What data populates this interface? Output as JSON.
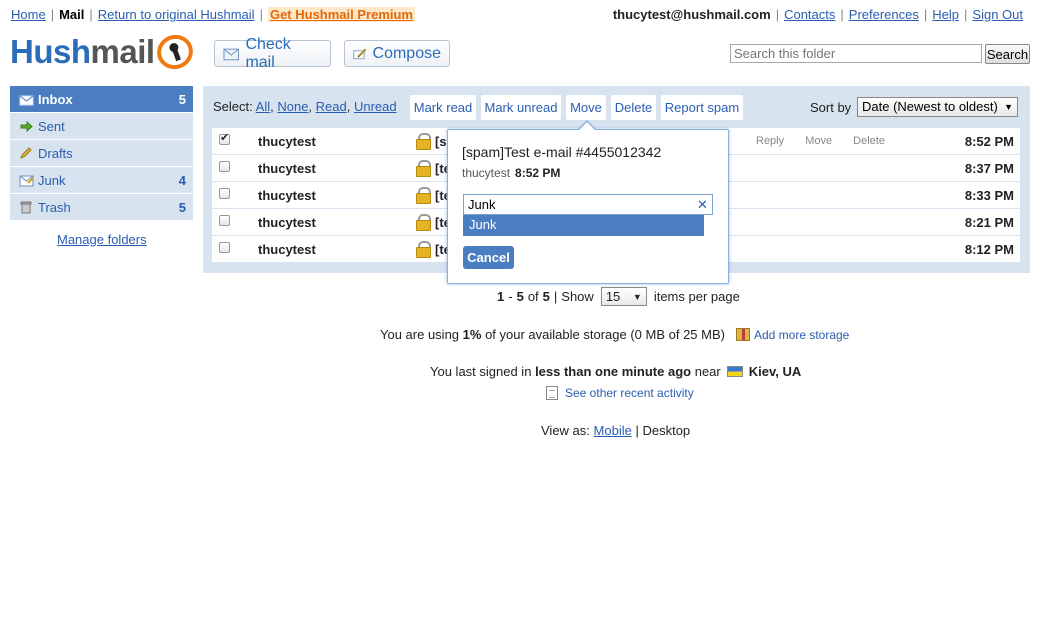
{
  "topnav": {
    "home": "Home",
    "mail": "Mail",
    "return": "Return to original Hushmail",
    "premium": "Get Hushmail Premium"
  },
  "usernav": {
    "email": "thucytest@hushmail.com",
    "contacts": "Contacts",
    "preferences": "Preferences",
    "help": "Help",
    "signout": "Sign Out"
  },
  "logo": {
    "hush": "Hush",
    "mail": "mail"
  },
  "header": {
    "check_mail": "Check mail",
    "compose": "Compose",
    "search_placeholder": "Search this folder",
    "search_button": "Search"
  },
  "sidebar": {
    "folders": [
      {
        "name": "Inbox",
        "count": "5",
        "icon": "inbox-icon"
      },
      {
        "name": "Sent",
        "count": "",
        "icon": "arrow-right-icon"
      },
      {
        "name": "Drafts",
        "count": "",
        "icon": "pencil-icon"
      },
      {
        "name": "Junk",
        "count": "4",
        "icon": "junk-icon"
      },
      {
        "name": "Trash",
        "count": "5",
        "icon": "trash-icon"
      }
    ],
    "manage": "Manage folders"
  },
  "toolbar": {
    "select_label": "Select:",
    "all": "All",
    "none": "None",
    "read": "Read",
    "unread": "Unread",
    "mark_read": "Mark read",
    "mark_unread": "Mark unread",
    "move": "Move",
    "delete": "Delete",
    "report_spam": "Report spam",
    "sort_label": "Sort by",
    "sort_value": "Date (Newest to oldest)"
  },
  "messages": [
    {
      "from": "thucytest",
      "subject": "[s",
      "time": "8:52 PM",
      "checked": true,
      "actions": [
        "Reply",
        "Move",
        "Delete"
      ]
    },
    {
      "from": "thucytest",
      "subject": "[te",
      "time": "8:37 PM",
      "checked": false
    },
    {
      "from": "thucytest",
      "subject": "[te",
      "time": "8:33 PM",
      "checked": false
    },
    {
      "from": "thucytest",
      "subject": "[te",
      "time": "8:21 PM",
      "checked": false
    },
    {
      "from": "thucytest",
      "subject": "[te",
      "time": "8:12 PM",
      "checked": false
    }
  ],
  "move_popup": {
    "subject": "[spam]Test e-mail #4455012342",
    "sender": "thucytest",
    "time": "8:52 PM",
    "input_value": "Junk",
    "suggestion": "Junk",
    "cancel": "Cancel"
  },
  "pager": {
    "start": "1",
    "end": "5",
    "of_label": "of",
    "total": "5",
    "show_label": "Show",
    "per_page": "15",
    "items_label": "items per page"
  },
  "storage": {
    "prefix": "You are using",
    "percent": "1%",
    "suffix": "of your available storage (0 MB of 25 MB)",
    "link": "Add more storage"
  },
  "signin": {
    "prefix": "You last signed in",
    "when": "less than one minute ago",
    "near": "near",
    "location": "Kiev, UA",
    "activity_link": "See other recent activity"
  },
  "viewas": {
    "label": "View as:",
    "mobile": "Mobile",
    "desktop": "Desktop"
  },
  "colors": {
    "brand_blue": "#2a6cb7",
    "accent_orange": "#f07a10",
    "panel_bg": "#d7e3ef",
    "active_blue": "#4a7ec0"
  }
}
